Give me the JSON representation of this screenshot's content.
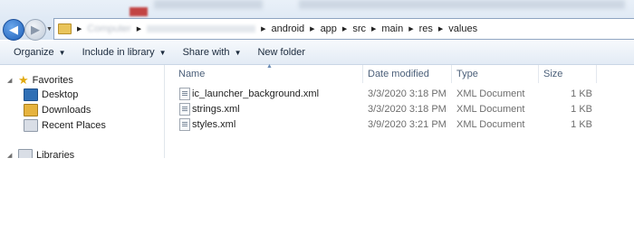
{
  "addressbar": {
    "blurred_segment": "Computer",
    "path": [
      "android",
      "app",
      "src",
      "main",
      "res",
      "values"
    ]
  },
  "toolbar": {
    "organize": "Organize",
    "include_in_library": "Include in library",
    "share_with": "Share with",
    "new_folder": "New folder"
  },
  "navpane": {
    "favorites_label": "Favorites",
    "items": [
      {
        "label": "Desktop",
        "icon": "desktop-icon"
      },
      {
        "label": "Downloads",
        "icon": "downloads-icon"
      },
      {
        "label": "Recent Places",
        "icon": "recent-places-icon"
      }
    ],
    "libraries_label": "Libraries"
  },
  "columns": {
    "name": "Name",
    "date_modified": "Date modified",
    "type": "Type",
    "size": "Size"
  },
  "files": [
    {
      "name": "ic_launcher_background.xml",
      "date": "3/3/2020 3:18 PM",
      "type": "XML Document",
      "size": "1 KB"
    },
    {
      "name": "strings.xml",
      "date": "3/3/2020 3:18 PM",
      "type": "XML Document",
      "size": "1 KB"
    },
    {
      "name": "styles.xml",
      "date": "3/9/2020 3:21 PM",
      "type": "XML Document",
      "size": "1 KB"
    }
  ],
  "colors": {
    "accent": "#1d5fb8",
    "folder": "#e9c45a",
    "header_text": "#4c607a"
  }
}
